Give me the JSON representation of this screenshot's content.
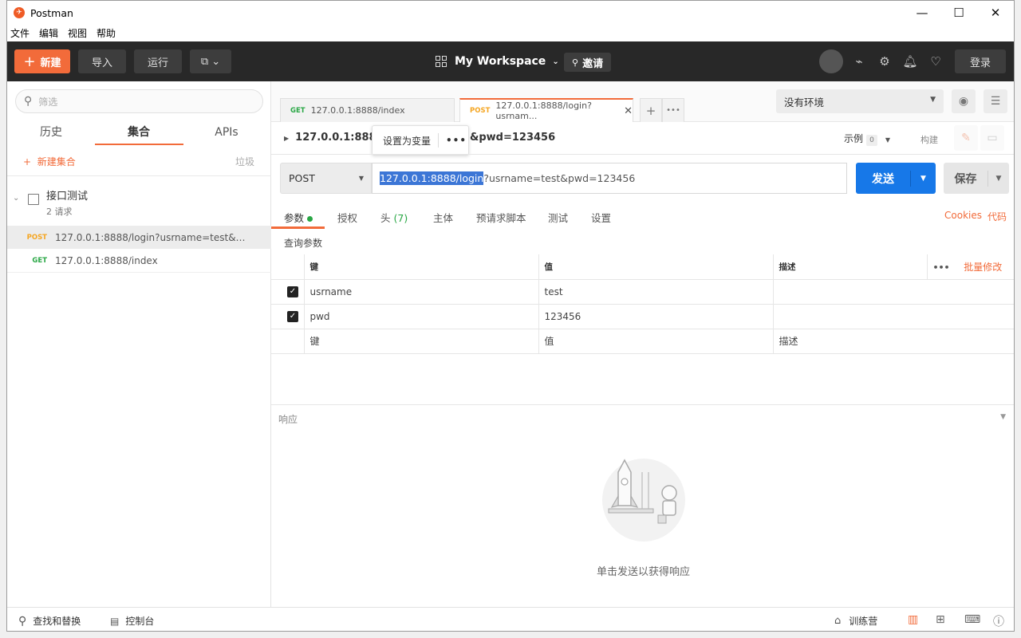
{
  "window": {
    "title": "Postman",
    "menu": [
      "文件",
      "编辑",
      "视图",
      "帮助"
    ]
  },
  "header": {
    "new_label": "新建",
    "import_label": "导入",
    "runner_label": "运行",
    "workspace": "My Workspace",
    "invite_label": "邀请",
    "login_label": "登录"
  },
  "sidebar": {
    "search_placeholder": "筛选",
    "tabs": [
      "历史",
      "集合",
      "APIs"
    ],
    "new_collection": "新建集合",
    "trash": "垃圾",
    "collection": {
      "name": "接口测试",
      "count": "2 请求"
    },
    "requests": [
      {
        "method": "POST",
        "url": "127.0.0.1:8888/login?usrname=test&pwd..."
      },
      {
        "method": "GET",
        "url": "127.0.0.1:8888/index"
      }
    ]
  },
  "main": {
    "tabs": [
      {
        "method": "GET",
        "label": "127.0.0.1:8888/index"
      },
      {
        "method": "POST",
        "label": "127.0.0.1:8888/login?usrnam..."
      }
    ],
    "environment": "没有环境",
    "breadcrumb": "127.0.0.1:8888/l",
    "breadcrumb_end": "&pwd=123456",
    "popup": {
      "label": "设置为变量",
      "dots": "•••"
    },
    "examples_label": "示例",
    "examples_count": "0",
    "build_label": "构建",
    "method": "POST",
    "url_selected": "127.0.0.1:8888/login",
    "url_rest": "?usrname=test&pwd=123456",
    "send_label": "发送",
    "save_label": "保存",
    "subtabs": {
      "params": "参数",
      "auth": "授权",
      "headers": "头",
      "headers_count": "(7)",
      "body": "主体",
      "prescript": "预请求脚本",
      "tests": "测试",
      "settings": "设置"
    },
    "cookies": "Cookies",
    "code": "代码",
    "query_title": "查询参数",
    "table": {
      "headers": [
        "键",
        "值",
        "描述"
      ],
      "bulk_edit": "批量修改",
      "rows": [
        {
          "key": "usrname",
          "value": "test"
        },
        {
          "key": "pwd",
          "value": "123456"
        }
      ],
      "placeholder": {
        "key": "键",
        "value": "值",
        "desc": "描述"
      }
    },
    "response_title": "响应",
    "response_hint": "单击发送以获得响应"
  },
  "footer": {
    "find_replace": "查找和替换",
    "console": "控制台",
    "bootcamp": "训练营"
  },
  "colors": {
    "accent": "#f26b3a",
    "send": "#1778e8",
    "post": "#f5a623",
    "get": "#29a745"
  }
}
